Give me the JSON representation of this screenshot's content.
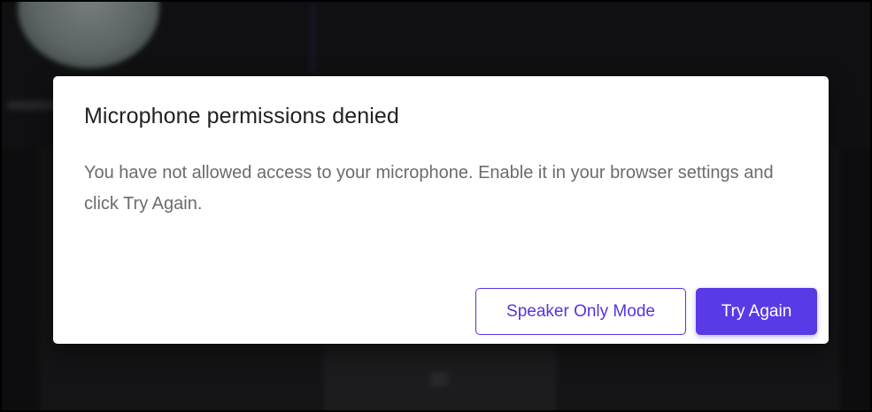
{
  "dialog": {
    "title": "Microphone permissions denied",
    "message": "You have not allowed access to your microphone. Enable it in your browser settings and click Try Again.",
    "secondary_button": "Speaker Only Mode",
    "primary_button": "Try Again"
  },
  "colors": {
    "accent": "#5a3ae6",
    "accent_text": "#5733e0",
    "backdrop": "#151517",
    "dialog_bg": "#ffffff"
  }
}
